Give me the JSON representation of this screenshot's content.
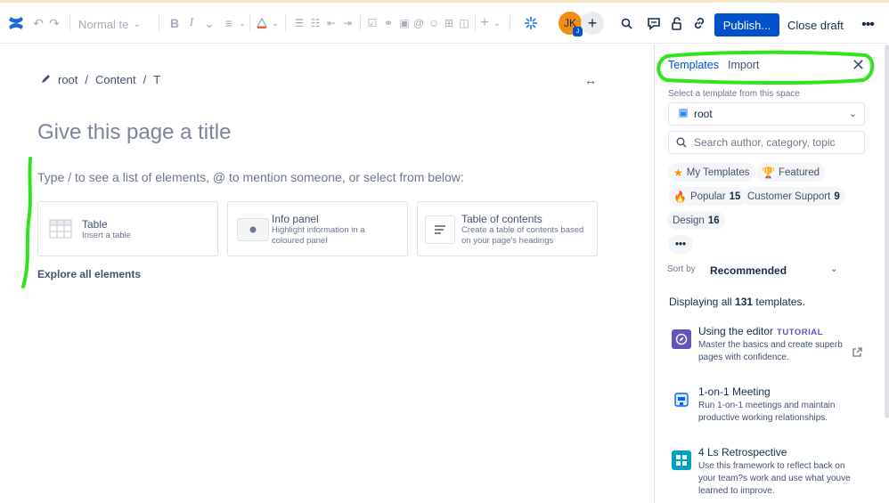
{
  "toolbar": {
    "text_style": "Normal te",
    "publish_label": "Publish...",
    "close_draft_label": "Close draft",
    "avatar_initials": "JK",
    "more_label": "•••"
  },
  "breadcrumb": {
    "items": [
      "root",
      "Content",
      "T"
    ]
  },
  "editor": {
    "title_placeholder": "Give this page a title",
    "hint": "Type / to see a list of elements, @ to mention someone, or select from below:",
    "cards": [
      {
        "title": "Table",
        "desc": "Insert a table"
      },
      {
        "title": "Info panel",
        "desc": "Highlight information in a coloured panel"
      },
      {
        "title": "Table of contents",
        "desc": "Create a table of contents based on your page's headings"
      }
    ],
    "explore": "Explore all elements"
  },
  "panel": {
    "tabs": [
      "Templates",
      "Import"
    ],
    "space_label": "Select a template from this space",
    "space_value": "root",
    "search_placeholder": "Search author, category, topic",
    "chips": [
      {
        "label": "My Templates",
        "count": ""
      },
      {
        "label": "Featured",
        "count": ""
      },
      {
        "label": "Popular",
        "count": "15"
      },
      {
        "label": "Customer Support",
        "count": "9"
      },
      {
        "label": "Design",
        "count": "16"
      },
      {
        "label": "•••",
        "count": ""
      }
    ],
    "sort_label": "Sort by",
    "sort_value": "Recommended",
    "displaying_prefix": "Displaying all",
    "displaying_count": "131",
    "displaying_suffix": "templates.",
    "templates": [
      {
        "title": "Using the editor",
        "badge": "TUTORIAL",
        "desc": "Master the basics and create superb pages with confidence.",
        "color": "#6554c0"
      },
      {
        "title": "1-on-1 Meeting",
        "badge": "",
        "desc": "Run 1-on-1 meetings and maintain productive working relationships.",
        "color": "#0065ff"
      },
      {
        "title": "4 Ls Retrospective",
        "badge": "",
        "desc": "Use this framework to reflect back on your team?s work and use what youve learned to improve.",
        "color": "#00a3bf"
      }
    ]
  },
  "colors": {
    "accent": "#0052cc",
    "annotation": "#2ee51c"
  }
}
